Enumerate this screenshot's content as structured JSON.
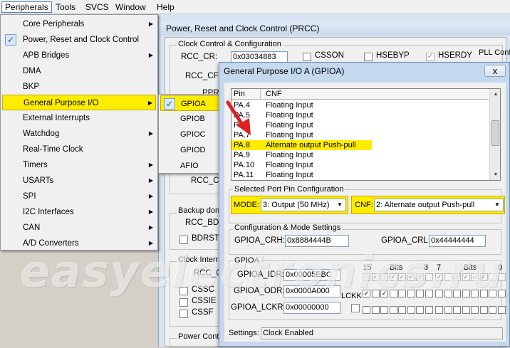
{
  "menubar": {
    "items": [
      "Peripherals",
      "Tools",
      "SVCS",
      "Window",
      "Help"
    ]
  },
  "peripherals_menu": {
    "items": [
      {
        "label": "Core Peripherals",
        "submenu": true,
        "checked": false
      },
      {
        "label": "Power, Reset and Clock Control",
        "submenu": false,
        "checked": true
      },
      {
        "label": "APB Bridges",
        "submenu": true,
        "checked": false
      },
      {
        "label": "DMA",
        "submenu": false,
        "checked": false
      },
      {
        "label": "BKP",
        "submenu": false,
        "checked": false
      },
      {
        "label": "General Purpose I/O",
        "submenu": true,
        "checked": false,
        "highlighted": true
      },
      {
        "label": "External Interrupts",
        "submenu": false,
        "checked": false
      },
      {
        "label": "Watchdog",
        "submenu": true,
        "checked": false
      },
      {
        "label": "Real-Time Clock",
        "submenu": false,
        "checked": false
      },
      {
        "label": "Timers",
        "submenu": true,
        "checked": false
      },
      {
        "label": "USARTs",
        "submenu": true,
        "checked": false
      },
      {
        "label": "SPI",
        "submenu": true,
        "checked": false
      },
      {
        "label": "I2C Interfaces",
        "submenu": true,
        "checked": false
      },
      {
        "label": "CAN",
        "submenu": true,
        "checked": false
      },
      {
        "label": "A/D Converters",
        "submenu": true,
        "checked": false
      }
    ],
    "tick": "✓",
    "arrow": "▶"
  },
  "gpio_submenu": {
    "items": [
      "GPIOA",
      "GPIOB",
      "GPIOC",
      "GPIOD",
      "AFIO"
    ],
    "checked_index": 0
  },
  "prcc_window": {
    "title": "Power, Reset and Clock Control (PRCC)",
    "group_clock": "Clock Control & Configuration",
    "rcc_cr_label": "RCC_CR:",
    "rcc_cr_value": "0x03034883",
    "csson": "CSSON",
    "hsebyp": "HSEBYP",
    "hserdy": "HSERDY",
    "pll_conf": "PLL Conf",
    "rcc_cfg_label": "RCC_CFG",
    "ppr_label": "PPR",
    "rcc_cs_label": "RCC_CS",
    "group_backup": "Backup don",
    "rcc_bd_label": "RCC_BDC",
    "bdrst": "BDRST",
    "group_interrupt": "Clock Interr",
    "rcc_c_label": "RCC_C",
    "cssc": "CSSC",
    "cssie": "CSSIE",
    "cssf": "CSSF",
    "group_power": "Power Cont"
  },
  "gpio_window": {
    "title": "General Purpose I/O A (GPIOA)",
    "close_label": "x",
    "list_headers": [
      "Pin",
      "CNF"
    ],
    "rows": [
      {
        "pin": "PA.4",
        "cnf": "Floating Input"
      },
      {
        "pin": "PA.5",
        "cnf": "Floating Input"
      },
      {
        "pin": "PA.6",
        "cnf": "Floating Input"
      },
      {
        "pin": "PA.7",
        "cnf": "Floating Input"
      },
      {
        "pin": "PA.8",
        "cnf": "Alternate output Push-pull"
      },
      {
        "pin": "PA.9",
        "cnf": "Floating Input"
      },
      {
        "pin": "PA.10",
        "cnf": "Floating Input"
      },
      {
        "pin": "PA.11",
        "cnf": "Floating Input"
      }
    ],
    "selected_row": 4,
    "selected_config_label": "Selected Port Pin Configuration",
    "mode_label": "MODE:",
    "mode_value": "3: Output (50 MHz)",
    "cnf_label": "CNF:",
    "cnf_value": "2: Alternate output Push-pull",
    "config_group_label": "Configuration & Mode Settings",
    "crh_label": "GPIOA_CRH:",
    "crh_value": "0x8884444B",
    "crl_label": "GPIOA_CRL:",
    "crl_value": "0x44444444",
    "gpioa_group_label": "GPIOA",
    "idr_label": "GPIOA_IDR:",
    "idr_value": "0x00005EBC",
    "odr_label": "GPIOA_ODR:",
    "odr_value": "0x0000A000",
    "lckr_label": "GPIOA_LCKR:",
    "lckr_value": "0x00000000",
    "lckk_label": "LCKK",
    "bits_15": "15",
    "bits_label": "Bits",
    "bits_8": "8",
    "bits_7": "7",
    "bits_0": "0",
    "idr_bits": [
      0,
      1,
      0,
      1,
      1,
      1,
      1,
      0,
      1,
      0,
      1,
      1,
      1,
      1,
      0,
      0
    ],
    "odr_bits": [
      1,
      0,
      1,
      0,
      0,
      0,
      0,
      0,
      0,
      0,
      0,
      0,
      0,
      0,
      0,
      0
    ],
    "settings_label": "Settings:",
    "settings_value": "Clock Enabled",
    "check_mark": "✓"
  },
  "watermark": "easyelectronics.ru",
  "colors": {
    "highlight": "#ffed00",
    "arrow": "#e02020"
  }
}
